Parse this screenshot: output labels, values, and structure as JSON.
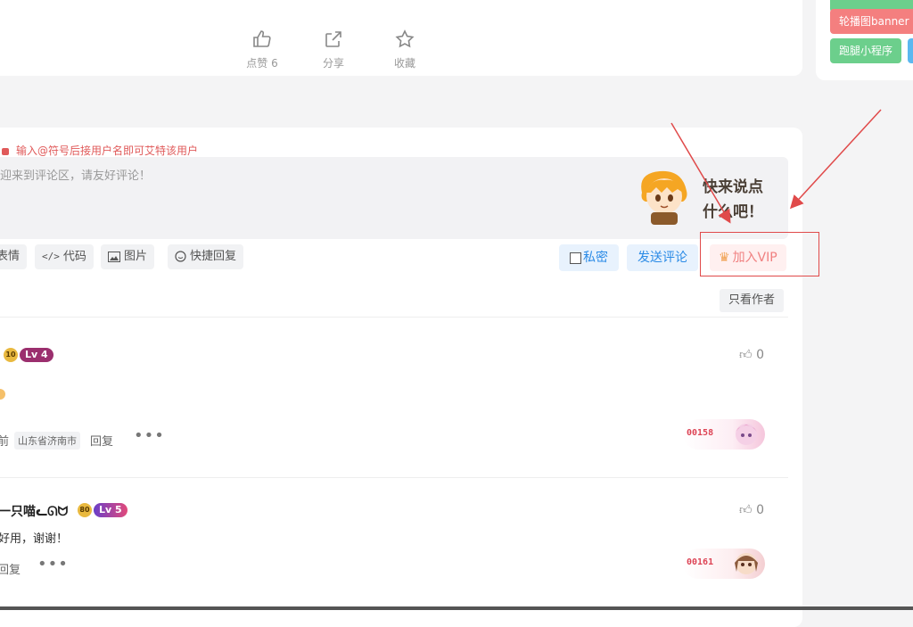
{
  "post_actions": {
    "like_label": "点赞",
    "like_count": "6",
    "share_label": "分享",
    "favorite_label": "收藏"
  },
  "sidebar_tags": [
    {
      "label": "轮播图banner",
      "color": "#f47f7f"
    },
    {
      "label": "跑腿小程序",
      "color": "#6ccf8c"
    }
  ],
  "comment_box": {
    "hint": "输入@符号后接用户名即可艾特该用户",
    "placeholder": "迎来到评论区，请友好评论！",
    "mascot_line1": "快来说点",
    "mascot_line2": "什么吧！",
    "tools": {
      "emoji": "表情",
      "code": "代码",
      "image": "图片",
      "quick_reply": "快捷回复"
    },
    "private_label": "私密",
    "submit_label": "发送评论",
    "vip_label": "加入VIP"
  },
  "filter": {
    "only_author": "只看作者"
  },
  "comments": [
    {
      "level": "4",
      "level_color": "#9b2f6e",
      "medal": "10",
      "content": "",
      "time_suffix": "前",
      "location": "山东省济南市",
      "reply": "回复",
      "likes": "0",
      "stamp_number": "00158"
    },
    {
      "name_fragment": "一只喵ᓚᘏᗢ",
      "level": "5",
      "level_color": "#e24a7a",
      "medal": "80",
      "content": "好用，谢谢！",
      "reply": "回复",
      "likes": "0",
      "stamp_number": "00161"
    }
  ],
  "annotation_color": "#e04a4a"
}
